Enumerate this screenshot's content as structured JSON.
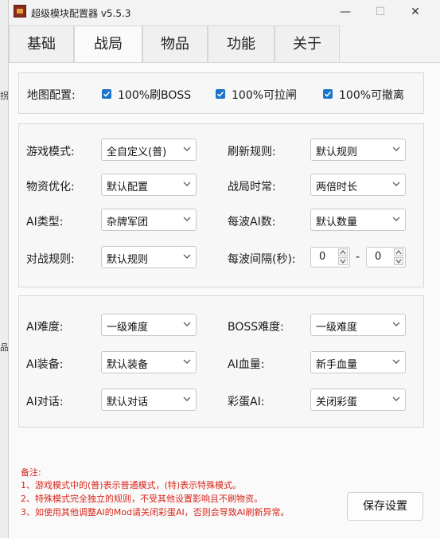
{
  "window": {
    "title": "超级模块配置器 v5.5.3",
    "minimize": "—",
    "maximize": "☐",
    "close": "✕"
  },
  "tabs": [
    "基础",
    "战局",
    "物品",
    "功能",
    "关于"
  ],
  "active_tab": "战局",
  "map_config": {
    "label": "地图配置:",
    "checkboxes": [
      {
        "label": "100%刷BOSS",
        "checked": true
      },
      {
        "label": "100%可拉闸",
        "checked": true
      },
      {
        "label": "100%可撤离",
        "checked": true
      }
    ]
  },
  "game_settings": {
    "mode_label": "游戏模式:",
    "mode_value": "全自定义(普)",
    "refresh_label": "刷新规则:",
    "refresh_value": "默认规则",
    "supply_label": "物资优化:",
    "supply_value": "默认配置",
    "duration_label": "战局时常:",
    "duration_value": "两倍时长",
    "ai_type_label": "AI类型:",
    "ai_type_value": "杂牌军团",
    "wave_ai_label": "每波AI数:",
    "wave_ai_value": "默认数量",
    "battle_rule_label": "对战规则:",
    "battle_rule_value": "默认规则",
    "wave_interval_label": "每波间隔(秒):",
    "interval_min": "0",
    "interval_sep": "-",
    "interval_max": "0"
  },
  "ai_settings": {
    "ai_difficulty_label": "AI难度:",
    "ai_difficulty_value": "一级难度",
    "boss_difficulty_label": "BOSS难度:",
    "boss_difficulty_value": "一级难度",
    "ai_equipment_label": "AI装备:",
    "ai_equipment_value": "默认装备",
    "ai_hp_label": "AI血量:",
    "ai_hp_value": "新手血量",
    "ai_dialog_label": "AI对话:",
    "ai_dialog_value": "默认对话",
    "easter_egg_label": "彩蛋AI:",
    "easter_egg_value": "关闭彩蛋"
  },
  "notes": [
    "备注:",
    "1、游戏模式中的(普)表示普通模式，(特)表示特殊模式。",
    "2、特殊模式完全独立的规则，不受其他设置影响且不刷物资。",
    "3、如使用其他调整AI的Mod请关闭彩蛋AI，否则会导致AI刷新异常。"
  ],
  "save_button": "保存设置",
  "background_fragments": [
    "拐",
    "品"
  ],
  "colors": {
    "accent": "#1b74c9",
    "note_red": "#d9261c"
  }
}
